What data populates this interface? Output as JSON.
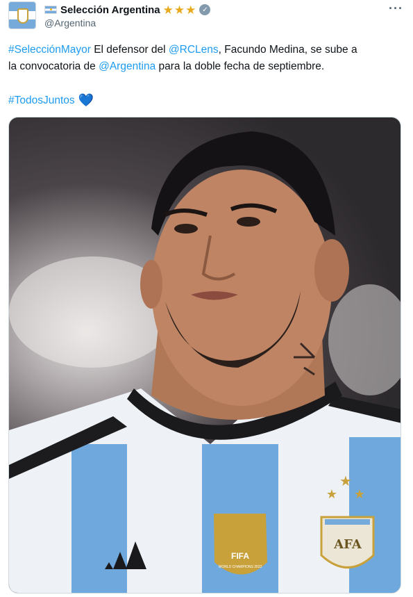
{
  "account": {
    "display_name": "Selección Argentina",
    "handle": "@Argentina",
    "avatar_icon": "afa-crest-avatar",
    "flag_icon": "argentina-flag-icon",
    "stars": [
      "★",
      "★",
      "★"
    ],
    "verified_icon": "verified-badge-icon",
    "more_label": "···"
  },
  "tweet": {
    "segments": {
      "hashtag_mayor": "#SelecciónMayor",
      "text1": " El defensor del ",
      "mention_lens": "@RCLens",
      "text2": ", Facundo Medina, se sube a",
      "text3": "la convocatoria de ",
      "mention_argentina": "@Argentina",
      "text4": " para la doble fecha de septiembre."
    },
    "hashtag_todos": "#TodosJuntos",
    "heart_emoji": "💙"
  },
  "media": {
    "description_icon": "player-photo",
    "fifa_badge_text": "FIFA",
    "fifa_badge_sub": "WORLD CHAMPIONS 2022",
    "afa_text": "AFA"
  },
  "colors": {
    "link": "#1d9bf0",
    "stripe_blue": "#75aadb",
    "gold": "#c9a13b"
  }
}
